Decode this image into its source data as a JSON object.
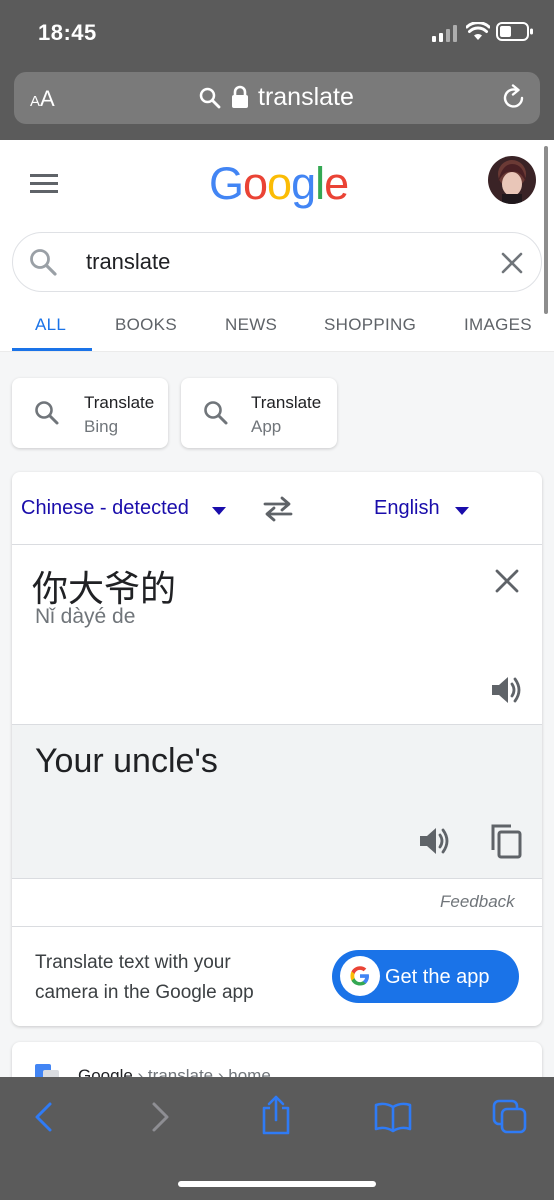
{
  "status_bar": {
    "time": "18:45"
  },
  "browser": {
    "aa_label_small": "A",
    "aa_label": "A",
    "address_text": "translate"
  },
  "google": {
    "logo_letters": [
      {
        "ch": "G",
        "color": "#4285f4"
      },
      {
        "ch": "o",
        "color": "#ea4335"
      },
      {
        "ch": "o",
        "color": "#fbbc05"
      },
      {
        "ch": "g",
        "color": "#4285f4"
      },
      {
        "ch": "l",
        "color": "#34a853"
      },
      {
        "ch": "e",
        "color": "#ea4335"
      }
    ],
    "query": "translate",
    "tabs": [
      "ALL",
      "BOOKS",
      "NEWS",
      "SHOPPING",
      "IMAGES"
    ],
    "active_tab": "ALL",
    "chips": [
      {
        "line1": "Translate",
        "line2": "Bing"
      },
      {
        "line1": "Translate",
        "line2": "App"
      }
    ]
  },
  "translate": {
    "source_language": "Chinese - detected",
    "target_language": "English",
    "source_text": "你大爷的",
    "transliteration": "Nǐ dàyé de",
    "translation": "Your uncle's",
    "feedback": "Feedback",
    "promo_line1": "Translate text with your",
    "promo_line2": "camera in the Google app",
    "get_app": "Get the app"
  },
  "next_result": {
    "site": "Google",
    "path": " › translate › home"
  },
  "colors": {
    "accent": "#1a73e8",
    "chrome": "#5b5b5b",
    "ios_blue": "#2f7bf5"
  }
}
